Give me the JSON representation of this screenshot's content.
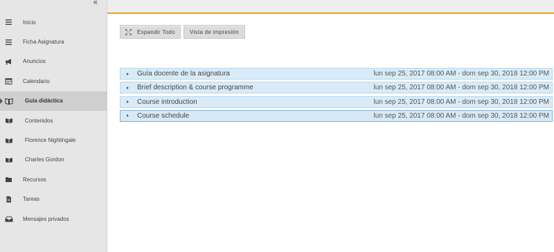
{
  "sidebar": {
    "collapse_glyph": "«",
    "items": [
      {
        "label": "Inicio",
        "icon": "hamburger-icon"
      },
      {
        "label": "Ficha Asignatura",
        "icon": "hamburger-icon"
      },
      {
        "label": "Anuncios",
        "icon": "megaphone-icon"
      },
      {
        "label": "Calendario",
        "icon": "calendar-icon"
      },
      {
        "label": "Guía didáctica",
        "icon": "book-open-icon",
        "active": true
      },
      {
        "label": "Contenidos",
        "icon": "book-icon"
      },
      {
        "label": "Florence Nightingale",
        "icon": "book-icon"
      },
      {
        "label": "Charles Gordon",
        "icon": "book-icon"
      },
      {
        "label": "Recursos",
        "icon": "folder-icon"
      },
      {
        "label": "Tareas",
        "icon": "document-icon"
      },
      {
        "label": "Mensajes privados",
        "icon": "inbox-icon"
      }
    ]
  },
  "toolbar": {
    "expand_label": "Expandir Todo",
    "print_label": "Vista de impresión"
  },
  "items": [
    {
      "title": "Guía docente de la asignatura",
      "dates": "lun sep 25, 2017 08:00 AM - dom sep 30, 2018 12:00 PM"
    },
    {
      "title": "Brief description & course programme",
      "dates": "lun sep 25, 2017 08:00 AM - dom sep 30, 2018 12:00 PM"
    },
    {
      "title": "Course introduction",
      "dates": "lun sep 25, 2017 08:00 AM - dom sep 30, 2018 12:00 PM"
    },
    {
      "title": "Course schedule",
      "dates": "lun sep 25, 2017 08:00 AM - dom sep 30, 2018 12:00 PM"
    }
  ],
  "colors": {
    "accent": "#f0a30a",
    "sidebar_bg": "#e6e6e6",
    "row_bg": "#d9ebf7",
    "row_border": "#b9d6ec",
    "expand_icon": "#5a9a3c"
  }
}
